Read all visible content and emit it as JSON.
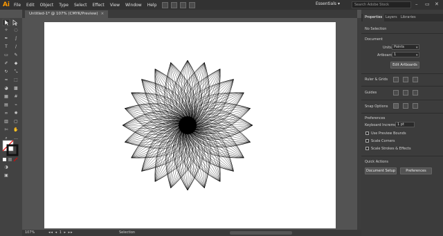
{
  "app": {
    "logo": "Ai"
  },
  "menu": [
    "File",
    "Edit",
    "Object",
    "Type",
    "Select",
    "Effect",
    "View",
    "Window",
    "Help"
  ],
  "workspace": {
    "label": "Essentials",
    "chevron": "▾"
  },
  "search": {
    "placeholder": "Search Adobe Stock"
  },
  "window_controls": {
    "minimize": "–",
    "maximize": "▭",
    "close": "✕"
  },
  "document_tab": {
    "title": "Untitled-1* @ 107% (CMYK/Preview)",
    "close": "×"
  },
  "status": {
    "zoom": "107%",
    "page_nav": "◂◂ ◂ 1 ▸ ▸▸",
    "mode": "Selection"
  },
  "panel": {
    "tabs": [
      "Properties",
      "Layers",
      "Libraries"
    ],
    "active_tab": "Properties",
    "selection": "No Selection",
    "document": {
      "title": "Document",
      "units_label": "Units:",
      "units_value": "Points",
      "artboard_label": "Artboard:",
      "artboard_value": "1",
      "edit_artboards": "Edit Artboards"
    },
    "rulers": {
      "title": "Ruler & Grids"
    },
    "guides": {
      "title": "Guides"
    },
    "snap": {
      "title": "Snap Options"
    },
    "preferences": {
      "title": "Preferences",
      "keyboard_label": "Keyboard Increment:",
      "keyboard_value": "1 pt",
      "use_preview_bounds": "Use Preview Bounds",
      "scale_corners": "Scale Corners",
      "scale_strokes": "Scale Strokes & Effects"
    },
    "quick_actions": {
      "title": "Quick Actions",
      "document_setup": "Document Setup",
      "preferences": "Preferences"
    }
  },
  "colors": {
    "accent": "#ff9a00",
    "menubar": "#323232",
    "panel": "#3c3c3c",
    "artboard": "#ffffff"
  }
}
